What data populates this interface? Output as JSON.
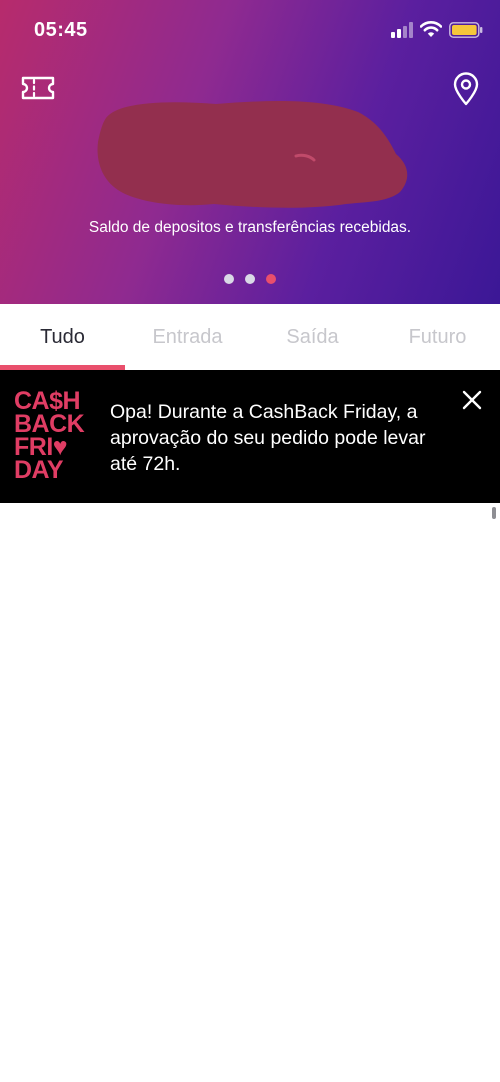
{
  "status_bar": {
    "time": "05:45",
    "signal_icon": "cellular-signal-icon",
    "wifi_icon": "wifi-icon",
    "battery_icon": "battery-icon",
    "battery_color": "#f5c63b"
  },
  "header": {
    "left_icon": "ticket-icon",
    "right_icon": "location-pin-icon",
    "balance_redacted": true,
    "balance_caption": "Saldo de depositos e transferências recebidas.",
    "carousel": {
      "page_count": 3,
      "active_index": 2,
      "active_color": "#e94f6c",
      "inactive_color": "#d9d9e6"
    }
  },
  "tabs": {
    "items": [
      {
        "label": "Tudo"
      },
      {
        "label": "Entrada"
      },
      {
        "label": "Saída"
      },
      {
        "label": "Futuro"
      }
    ],
    "active_index": 0,
    "indicator_color": "#e94f6c"
  },
  "banner": {
    "logo_lines": [
      "CA$H",
      "BACK",
      "FRI♥",
      "DAY"
    ],
    "logo_color": "#e03d64",
    "message": "Opa! Durante a CashBack Friday, a aprovação do seu pedido pode levar até 72h.",
    "close_icon": "close-icon"
  }
}
